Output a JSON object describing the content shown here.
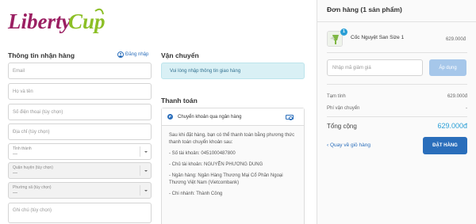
{
  "logo": {
    "text_part1": "Liberty",
    "text_part2": "Cup",
    "color1": "#9b1f62",
    "color2": "#8cbf26"
  },
  "customer": {
    "title": "Thông tin nhận hàng",
    "login_label": "Đăng nhập",
    "email_placeholder": "Email",
    "name_placeholder": "Họ và tên",
    "phone_placeholder": "Số điện thoại (tùy chọn)",
    "address_placeholder": "Địa chỉ (tùy chọn)",
    "province_label": "Tỉnh thành",
    "province_value": "---",
    "district_label": "Quận huyện (tùy chọn)",
    "district_value": "---",
    "ward_label": "Phường xã (tùy chọn)",
    "ward_value": "---",
    "note_placeholder": "Ghi chú (tùy chọn)"
  },
  "shipping": {
    "title": "Vận chuyển",
    "message": "Vui lòng nhập thông tin giao hàng"
  },
  "payment": {
    "title": "Thanh toán",
    "method": "Chuyển khoản qua ngân hàng",
    "instructions": "Sau khi đặt hàng, bạn có thể thanh toán bằng phương thức thanh toán chuyển khoản sau:",
    "account_number": "- Số tài khoản: 0451000487800",
    "account_holder": "- Chủ tài khoản: NGUYỄN PHƯƠNG DUNG",
    "bank": "- Ngân hàng: Ngân Hàng Thương Mại Cổ Phần Ngoại Thương Việt Nam (Vietcombank)",
    "branch": "- Chi nhánh: Thành Công"
  },
  "order": {
    "title": "Đơn hàng (1 sản phẩm)",
    "item": {
      "qty": "1",
      "name": "Cốc Nguyệt San Size 1",
      "price": "629.000đ"
    },
    "coupon_placeholder": "Nhập mã giảm giá",
    "coupon_button": "Áp dụng",
    "subtotal_label": "Tạm tính",
    "subtotal_value": "629.000đ",
    "shipping_label": "Phí vận chuyển",
    "shipping_value": "-",
    "total_label": "Tổng cộng",
    "total_value": "629.000đ",
    "back_link": "Quay về giỏ hàng",
    "place_order": "ĐẶT HÀNG"
  }
}
